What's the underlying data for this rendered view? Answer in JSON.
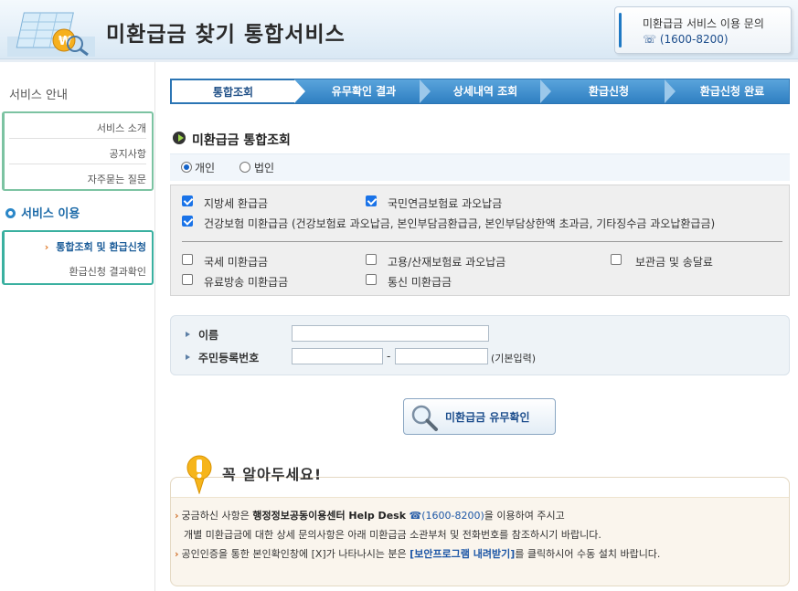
{
  "header": {
    "title": "미환급금 찾기 통합서비스",
    "contact_title": "미환급금 서비스 이용 문의",
    "contact_phone": "(1600-8200)"
  },
  "sidebar": {
    "section1": "서비스 안내",
    "section1_items": [
      "서비스 소개",
      "공지사항",
      "자주묻는 질문"
    ],
    "section2": "서비스 이용",
    "section2_items": [
      {
        "label": "통합조회 및 환급신청",
        "active": true
      },
      {
        "label": "환급신청 결과확인",
        "active": false
      }
    ]
  },
  "steps": [
    "통합조회",
    "유무확인 결과",
    "상세내역 조회",
    "환급신청",
    "환급신청 완료"
  ],
  "section_title": "미환급금 통합조회",
  "radios": [
    {
      "label": "개인",
      "checked": true
    },
    {
      "label": "법인",
      "checked": false
    }
  ],
  "checks_top": [
    {
      "label": "지방세 환급금",
      "checked": true
    },
    {
      "label": "국민연금보험료 과오납금",
      "checked": true
    },
    {
      "label": "건강보험 미환급금 (건강보험료 과오납금, 본인부담금환급금, 본인부담상한액 초과금, 기타징수금 과오납환급금)",
      "checked": true
    }
  ],
  "checks_bottom": [
    {
      "label": "국세 미환급금",
      "checked": false
    },
    {
      "label": "고용/산재보험료 과오납금",
      "checked": false
    },
    {
      "label": "보관금 및 송달료",
      "checked": false
    },
    {
      "label": "유료방송 미환급금",
      "checked": false
    },
    {
      "label": "통신 미환급금",
      "checked": false
    }
  ],
  "form": {
    "name_label": "이름",
    "id_label": "주민등록번호",
    "name_value": "",
    "id_front_value": "",
    "id_back_value": "",
    "dash": "-",
    "id_hint": "(기본입력)"
  },
  "search_button": {
    "label_bold": "미환급금",
    "label_rest": " 유무확인"
  },
  "notice": {
    "title": "꼭 알아두세요!",
    "line1_a": "궁금하신 사항은 ",
    "line1_bold": "행정정보공동이용센터 Help Desk",
    "line1_phone": "(1600-8200)",
    "line1_b": "을 이용하여 주시고",
    "line2": "개별 미환급금에 대한 상세 문의사항은 아래 미환급금 소관부처 및 전화번호를 참조하시기 바랍니다.",
    "line3_a": "공인인증을 통한 본인확인창에 [X]가 나타나시는 분은 ",
    "line3_link": "[보안프로그램 내려받기]",
    "line3_b": "를 클릭하시어 수동 설치 바랍니다."
  }
}
